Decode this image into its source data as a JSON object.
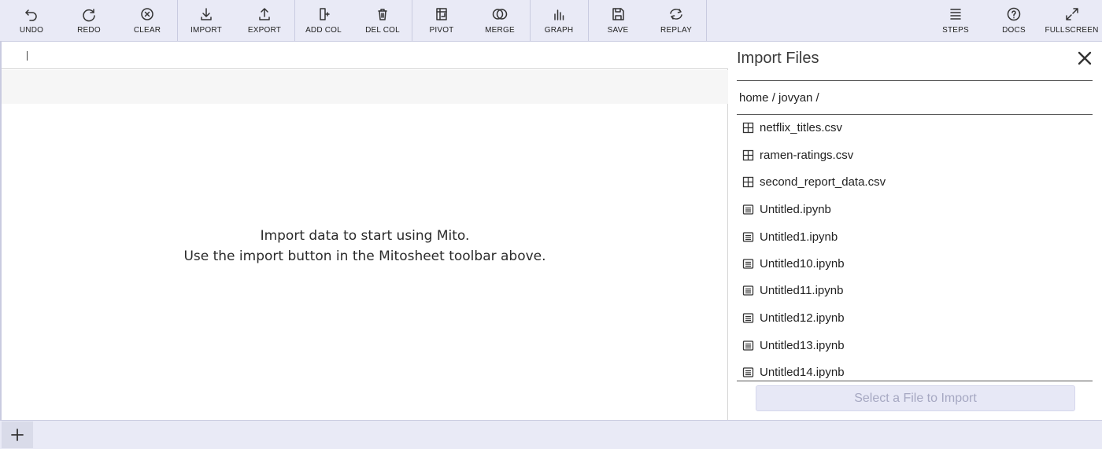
{
  "toolbar": {
    "left_buttons": [
      {
        "label": "UNDO",
        "icon": "undo-icon"
      },
      {
        "label": "REDO",
        "icon": "redo-icon"
      },
      {
        "label": "CLEAR",
        "icon": "clear-icon"
      },
      {
        "label": "IMPORT",
        "icon": "import-icon"
      },
      {
        "label": "EXPORT",
        "icon": "export-icon"
      },
      {
        "label": "ADD COL",
        "icon": "add-column-icon"
      },
      {
        "label": "DEL COL",
        "icon": "delete-column-icon"
      },
      {
        "label": "PIVOT",
        "icon": "pivot-icon"
      },
      {
        "label": "MERGE",
        "icon": "merge-icon"
      },
      {
        "label": "GRAPH",
        "icon": "graph-icon"
      },
      {
        "label": "SAVE",
        "icon": "save-icon"
      },
      {
        "label": "REPLAY",
        "icon": "replay-icon"
      }
    ],
    "right_buttons": [
      {
        "label": "STEPS",
        "icon": "steps-icon"
      },
      {
        "label": "DOCS",
        "icon": "docs-icon"
      },
      {
        "label": "FULLSCREEN",
        "icon": "fullscreen-icon"
      }
    ]
  },
  "sheet": {
    "empty_message_line1": "Import data to start using Mito.",
    "empty_message_line2": "Use the import button in the Mitosheet toolbar above."
  },
  "import_panel": {
    "title": "Import Files",
    "breadcrumb": "home / jovyan /",
    "files": [
      {
        "name": "netflix_titles.csv",
        "type": "csv"
      },
      {
        "name": "ramen-ratings.csv",
        "type": "csv"
      },
      {
        "name": "second_report_data.csv",
        "type": "csv"
      },
      {
        "name": "Untitled.ipynb",
        "type": "notebook"
      },
      {
        "name": "Untitled1.ipynb",
        "type": "notebook"
      },
      {
        "name": "Untitled10.ipynb",
        "type": "notebook"
      },
      {
        "name": "Untitled11.ipynb",
        "type": "notebook"
      },
      {
        "name": "Untitled12.ipynb",
        "type": "notebook"
      },
      {
        "name": "Untitled13.ipynb",
        "type": "notebook"
      },
      {
        "name": "Untitled14.ipynb",
        "type": "notebook"
      }
    ],
    "import_button_label": "Select a File to Import"
  },
  "colors": {
    "toolbar_bg": "#e9eaf6",
    "disabled_button_text": "#a6a8c2"
  }
}
